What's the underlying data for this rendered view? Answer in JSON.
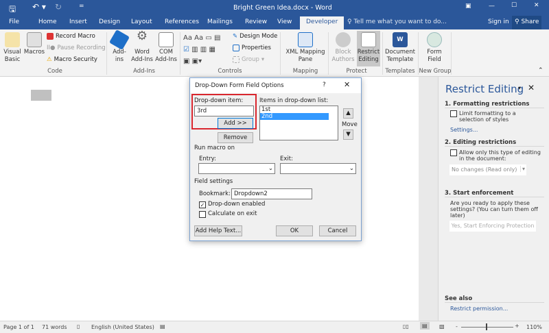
{
  "title": "Bright Green Idea.docx - Word",
  "qat": {
    "save": "save-icon",
    "undo": "undo-icon",
    "redo": "redo-icon"
  },
  "tabs": [
    "File",
    "Home",
    "Insert",
    "Design",
    "Layout",
    "References",
    "Mailings",
    "Review",
    "View",
    "Developer"
  ],
  "active_tab": "Developer",
  "tell_me": "Tell me what you want to do...",
  "sign_in": "Sign in",
  "share": "Share",
  "ribbon": {
    "code": {
      "label": "Code",
      "visual_basic": "Visual Basic",
      "macros": "Macros",
      "record": "Record Macro",
      "pause": "Pause Recording",
      "security": "Macro Security"
    },
    "addins": {
      "label": "Add-Ins",
      "addins": "Add-ins",
      "word": "Word Add-Ins",
      "com": "COM Add-Ins"
    },
    "controls": {
      "label": "Controls",
      "design": "Design Mode",
      "properties": "Properties",
      "group": "Group"
    },
    "mapping": {
      "label": "Mapping",
      "xml": "XML Mapping Pane"
    },
    "protect": {
      "label": "Protect",
      "block": "Block Authors",
      "restrict": "Restrict Editing"
    },
    "templates": {
      "label": "Templates",
      "doc": "Document Template"
    },
    "newgroup": {
      "label": "New Group",
      "form": "Form Field"
    }
  },
  "dialog": {
    "title": "Drop-Down Form Field Options",
    "help": "?",
    "item_label": "Drop-down item:",
    "item_value": "3rd",
    "add": "Add >>",
    "remove": "Remove",
    "list_label": "Items in drop-down list:",
    "items": [
      "1st",
      "2nd"
    ],
    "selected": "2nd",
    "move": "Move",
    "run_macro": "Run macro on",
    "entry": "Entry:",
    "exit": "Exit:",
    "field_settings": "Field settings",
    "bookmark_label": "Bookmark:",
    "bookmark": "Dropdown2",
    "enabled": "Drop-down enabled",
    "enabled_checked": true,
    "calc": "Calculate on exit",
    "calc_checked": false,
    "help_text": "Add Help Text...",
    "ok": "OK",
    "cancel": "Cancel"
  },
  "panel": {
    "title": "Restrict Editing",
    "s1": "1. Formatting restrictions",
    "s1_check": "Limit formatting to a selection of styles",
    "settings": "Settings...",
    "s2": "2. Editing restrictions",
    "s2_check": "Allow only this type of editing in the document:",
    "s2_select": "No changes (Read only)",
    "s3": "3. Start enforcement",
    "s3_text": "Are you ready to apply these settings? (You can turn them off later)",
    "s3_btn": "Yes, Start Enforcing Protection",
    "see_also": "See also",
    "permission": "Restrict permission..."
  },
  "status": {
    "page": "Page 1 of 1",
    "words": "71 words",
    "lang": "English (United States)",
    "zoom": "110%",
    "zoom_level": 1.1
  },
  "colors": {
    "brand": "#2b579a",
    "highlight": "#3399ff",
    "callout": "#d9262e"
  }
}
